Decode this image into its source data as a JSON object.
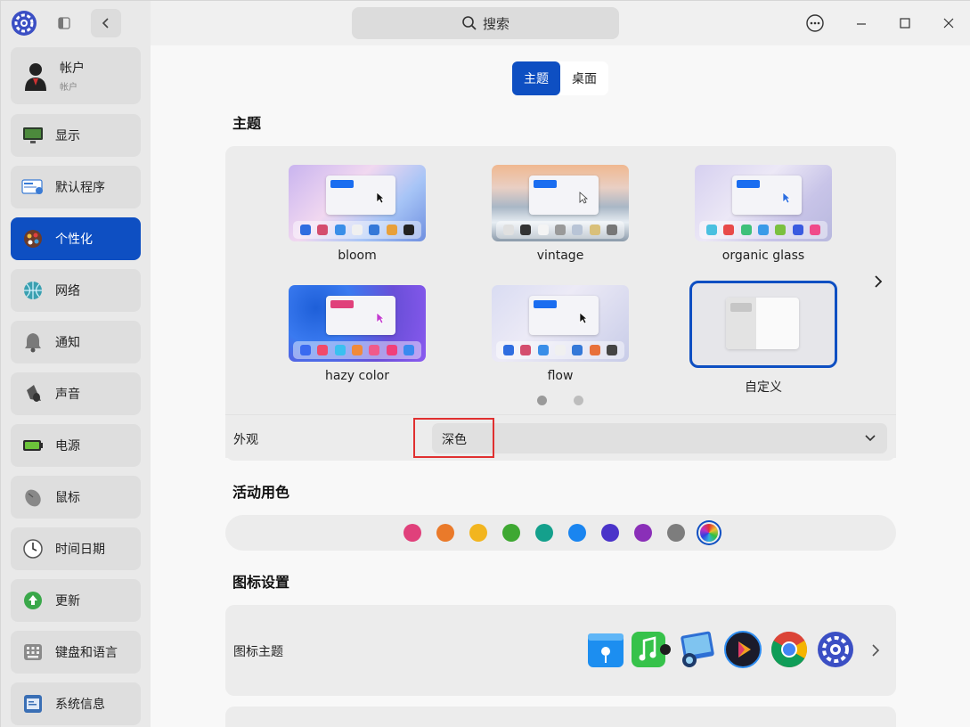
{
  "sidebar": {
    "account": {
      "name": "帐户",
      "subtitle": "帐户"
    },
    "items": [
      {
        "label": "显示",
        "icon": "monitor-icon"
      },
      {
        "label": "默认程序",
        "icon": "default-apps-icon"
      },
      {
        "label": "个性化",
        "icon": "personalization-icon",
        "active": true
      },
      {
        "label": "网络",
        "icon": "network-icon"
      },
      {
        "label": "通知",
        "icon": "bell-icon"
      },
      {
        "label": "声音",
        "icon": "speaker-icon"
      },
      {
        "label": "电源",
        "icon": "battery-icon"
      },
      {
        "label": "鼠标",
        "icon": "mouse-icon"
      },
      {
        "label": "时间日期",
        "icon": "clock-icon"
      },
      {
        "label": "更新",
        "icon": "update-icon"
      },
      {
        "label": "键盘和语言",
        "icon": "keyboard-icon"
      },
      {
        "label": "系统信息",
        "icon": "system-info-icon"
      }
    ]
  },
  "titlebar": {
    "search_label": "搜索"
  },
  "tabs": [
    {
      "label": "主题",
      "active": true
    },
    {
      "label": "桌面",
      "active": false
    }
  ],
  "theme_section": {
    "title": "主题",
    "themes": [
      {
        "name": "bloom"
      },
      {
        "name": "vintage"
      },
      {
        "name": "organic glass"
      },
      {
        "name": "hazy color"
      },
      {
        "name": "flow"
      },
      {
        "name": "自定义",
        "selected": true
      }
    ],
    "page_indicator": {
      "current": 1,
      "total": 2
    }
  },
  "appearance": {
    "label": "外观",
    "value": "深色"
  },
  "accent_section": {
    "title": "活动用色",
    "colors": [
      "#e0407b",
      "#ea7a2a",
      "#f2b51f",
      "#3ea832",
      "#14a08c",
      "#1a85f0",
      "#4a33c9",
      "#8a2fb8",
      "#7d7d7d",
      "multicolor"
    ],
    "selected_index": 9
  },
  "icon_section": {
    "title": "图标设置",
    "row_label": "图标主题"
  },
  "colors": {
    "accent": "#0e4fc2",
    "highlight": "#e03030"
  }
}
